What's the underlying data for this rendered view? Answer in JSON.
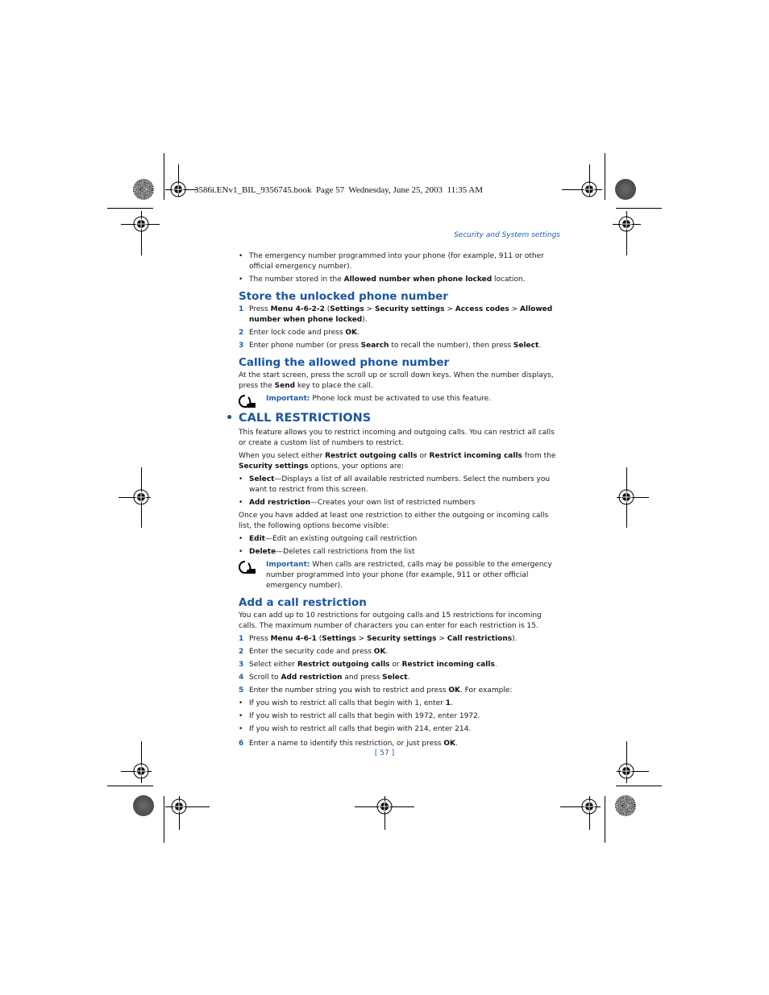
{
  "print_header": {
    "book_line": "3586i.ENv1_BIL_9356745.book  Page 57  Wednesday, June 25, 2003  11:35 AM"
  },
  "running_head": "Security and System settings",
  "intro_bullets": [
    "The emergency number programmed into your phone (for example, 911 or other official emergency number).",
    {
      "pre": "The number stored in the ",
      "bold": "Allowed number when phone locked",
      "post": " location."
    }
  ],
  "store_section": {
    "heading": "Store the unlocked phone number",
    "steps": [
      {
        "num": "1",
        "parts": [
          [
            "t",
            "Press "
          ],
          [
            "b",
            "Menu 4-6-2-2"
          ],
          [
            "t",
            " ("
          ],
          [
            "b",
            "Settings"
          ],
          [
            "t",
            " > "
          ],
          [
            "b",
            "Security settings"
          ],
          [
            "t",
            " > "
          ],
          [
            "b",
            "Access codes"
          ],
          [
            "t",
            " > "
          ],
          [
            "b",
            "Allowed number when phone locked"
          ],
          [
            "t",
            ")."
          ]
        ]
      },
      {
        "num": "2",
        "parts": [
          [
            "t",
            "Enter lock code and press "
          ],
          [
            "b",
            "OK"
          ],
          [
            "t",
            "."
          ]
        ]
      },
      {
        "num": "3",
        "parts": [
          [
            "t",
            "Enter phone number (or press "
          ],
          [
            "b",
            "Search"
          ],
          [
            "t",
            " to recall the number), then press "
          ],
          [
            "b",
            "Select"
          ],
          [
            "t",
            "."
          ]
        ]
      }
    ]
  },
  "calling_section": {
    "heading": "Calling the allowed phone number",
    "body_parts": [
      [
        "t",
        "At the start screen, press the scroll up or scroll down keys. When the number displays, press the "
      ],
      [
        "b",
        "Send"
      ],
      [
        "t",
        " key to place the call."
      ]
    ],
    "important_label": "Important:",
    "important_text": " Phone lock must be activated to use this feature."
  },
  "restrictions_section": {
    "heading": "CALL RESTRICTIONS",
    "intro": "This feature allows you to restrict incoming and outgoing calls. You can restrict all calls or create a custom list of numbers to restrict.",
    "options_intro_parts": [
      [
        "t",
        "When you select either "
      ],
      [
        "b",
        "Restrict outgoing calls"
      ],
      [
        "t",
        " or "
      ],
      [
        "b",
        "Restrict incoming calls"
      ],
      [
        "t",
        " from the "
      ],
      [
        "b",
        "Security settings"
      ],
      [
        "t",
        " options, your options are:"
      ]
    ],
    "options": [
      {
        "name": "Select",
        "desc": "—Displays a list of all available restricted numbers. Select the numbers you want to restrict from this screen."
      },
      {
        "name": "Add restriction",
        "desc": "—Creates your own list of restricted numbers"
      }
    ],
    "after_intro": "Once you have added at least one restriction to either the outgoing or incoming calls list, the following options become visible:",
    "after_options": [
      {
        "name": "Edit",
        "desc": "—Edit an existing outgoing call restriction"
      },
      {
        "name": "Delete",
        "desc": "—Deletes call restrictions from the list"
      }
    ],
    "important_label": "Important:",
    "important_text": " When calls are restricted, calls may be possible to the emergency number programmed into your phone (for example, 911 or other official emergency number)."
  },
  "add_section": {
    "heading": "Add a call restriction",
    "intro": "You can add up to 10 restrictions for outgoing calls and 15 restrictions for incoming calls. The maximum number of characters you can enter for each restriction is 15.",
    "steps": [
      {
        "num": "1",
        "parts": [
          [
            "t",
            "Press "
          ],
          [
            "b",
            "Menu 4-6-1"
          ],
          [
            "t",
            " ("
          ],
          [
            "b",
            "Settings"
          ],
          [
            "t",
            " > "
          ],
          [
            "b",
            "Security settings"
          ],
          [
            "t",
            " > "
          ],
          [
            "b",
            "Call restrictions"
          ],
          [
            "t",
            ")."
          ]
        ]
      },
      {
        "num": "2",
        "parts": [
          [
            "t",
            "Enter the security code and press "
          ],
          [
            "b",
            "OK"
          ],
          [
            "t",
            "."
          ]
        ]
      },
      {
        "num": "3",
        "parts": [
          [
            "t",
            "Select either "
          ],
          [
            "b",
            "Restrict outgoing calls"
          ],
          [
            "t",
            " or "
          ],
          [
            "b",
            "Restrict incoming calls"
          ],
          [
            "t",
            "."
          ]
        ]
      },
      {
        "num": "4",
        "parts": [
          [
            "t",
            "Scroll to "
          ],
          [
            "b",
            "Add restriction"
          ],
          [
            "t",
            " and press "
          ],
          [
            "b",
            "Select"
          ],
          [
            "t",
            "."
          ]
        ]
      },
      {
        "num": "5",
        "parts": [
          [
            "t",
            "Enter the number string you wish to restrict and press "
          ],
          [
            "b",
            "OK"
          ],
          [
            "t",
            ". For example:"
          ]
        ]
      }
    ],
    "examples": [
      [
        [
          "t",
          "If you wish to restrict all calls that begin with 1, enter "
        ],
        [
          "b",
          "1"
        ],
        [
          "t",
          "."
        ]
      ],
      [
        [
          "t",
          "If you wish to restrict all calls that begin with 1972, enter 1972."
        ]
      ],
      [
        [
          "t",
          "If you wish to restrict all calls that begin with 214, enter 214."
        ]
      ]
    ],
    "final_step": {
      "num": "6",
      "parts": [
        [
          "t",
          "Enter a name to identify this restriction, or just press "
        ],
        [
          "b",
          "OK"
        ],
        [
          "t",
          "."
        ]
      ]
    }
  },
  "page_number": "[ 57 ]",
  "icons": {
    "registration_mark": "crosshair-circle",
    "color_disc_star": "starburst-disc",
    "color_disc_gray": "gray-disc",
    "important": "hand-pointer-icon"
  },
  "colors": {
    "heading": "#1a56a0",
    "accent": "#1f5fa6",
    "text": "#1a1a1a"
  }
}
